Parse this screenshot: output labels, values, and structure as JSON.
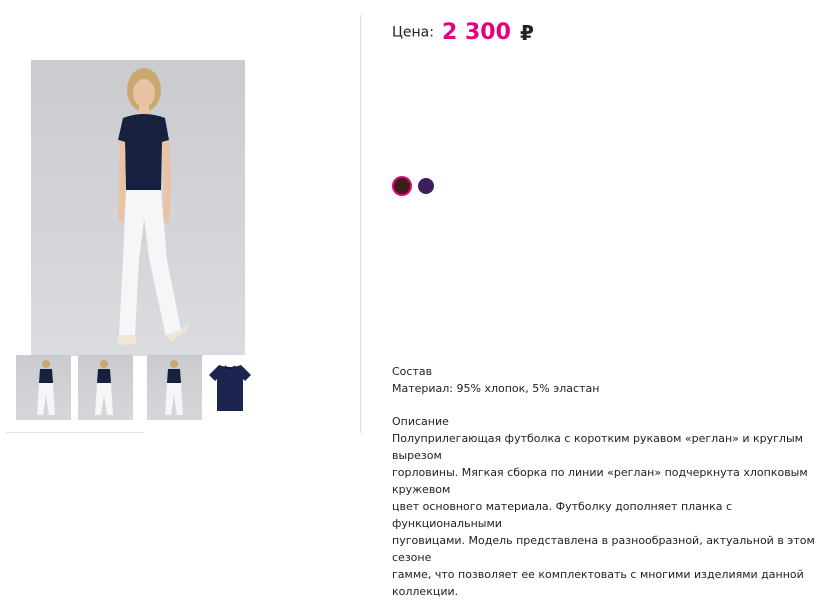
{
  "price": {
    "label": "Цена:",
    "value": "2 300",
    "currency": "₽"
  },
  "colors": {
    "accent": "#e5007d",
    "swatches": [
      {
        "name": "brown",
        "color": "#3b1f18",
        "selected": true
      },
      {
        "name": "purple",
        "color": "#3c1f5f",
        "selected": false
      }
    ]
  },
  "composition": {
    "title": "Состав",
    "material": "Материал: 95% хлопок, 5% эластан"
  },
  "description": {
    "title": "Описание",
    "lines": [
      "Полуприлегающая футболка с коротким рукавом «реглан» и круглым вырезом",
      "горловины. Мягкая сборка по линии «реглан» подчеркнута хлопковым кружевом",
      "цвет основного материала. Футболку дополняет планка с функциональными",
      "пуговицами. Модель представлена в разнообразной, актуальной в этом сезоне",
      "гамме, что позволяет ее комплектовать с многими изделиями данной коллекции."
    ]
  }
}
